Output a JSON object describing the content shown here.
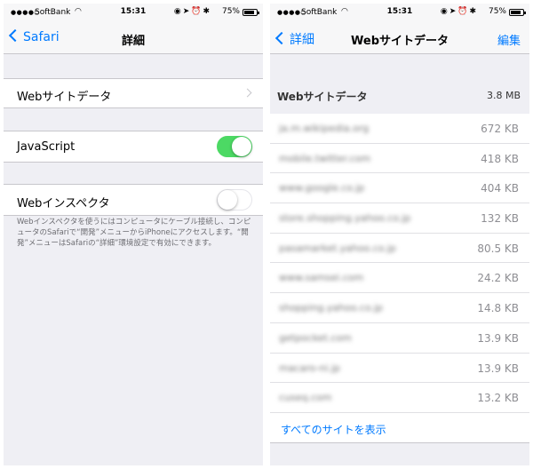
{
  "status_bar": {
    "carrier": "SoftBank",
    "time": "15:31",
    "battery": "75%"
  },
  "left": {
    "back_label": "Safari",
    "title": "詳細",
    "rows": {
      "website_data": "Webサイトデータ",
      "javascript": "JavaScript",
      "web_inspector": "Webインスペクタ"
    },
    "javascript_enabled": true,
    "web_inspector_enabled": false,
    "footer": "Webインスペクタを使うにはコンピュータにケーブル接続し、コンピュータのSafariで“開発”メニューからiPhoneにアクセスします。“開発”メニューはSafariの“詳細”環境設定で有効にできます。"
  },
  "right": {
    "back_label": "詳細",
    "title": "Webサイトデータ",
    "edit_label": "編集",
    "group_label": "Webサイトデータ",
    "group_total": "3.8 MB",
    "sites": [
      {
        "domain": "ja.m.wikipedia.org",
        "size": "672 KB"
      },
      {
        "domain": "mobile.twitter.com",
        "size": "418 KB"
      },
      {
        "domain": "www.google.co.jp",
        "size": "404 KB"
      },
      {
        "domain": "store.shopping.yahoo.co.jp",
        "size": "132 KB"
      },
      {
        "domain": "pasamarket.yahoo.co.jp",
        "size": "80.5 KB"
      },
      {
        "domain": "www.samsei.com",
        "size": "24.2 KB"
      },
      {
        "domain": "shopping.yahoo.co.jp",
        "size": "14.8 KB"
      },
      {
        "domain": "getpocket.com",
        "size": "13.9 KB"
      },
      {
        "domain": "macaro-ni.jp",
        "size": "13.9 KB"
      },
      {
        "domain": "cuseq.com",
        "size": "13.2 KB"
      }
    ],
    "show_all": "すべてのサイトを表示"
  },
  "colors": {
    "accent": "#007aff",
    "toggle_on": "#4cd964",
    "background": "#efeff4"
  }
}
